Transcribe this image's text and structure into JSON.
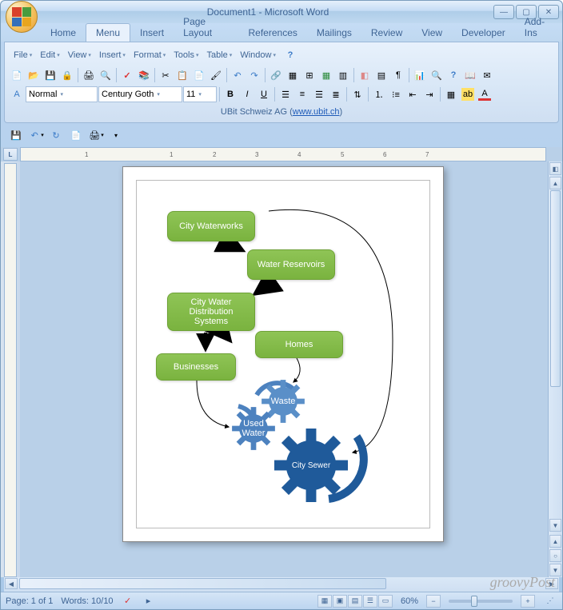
{
  "window": {
    "title": "Document1 - Microsoft Word"
  },
  "tabs": [
    "Home",
    "Menu",
    "Insert",
    "Page Layout",
    "References",
    "Mailings",
    "Review",
    "View",
    "Developer",
    "Add-Ins"
  ],
  "active_tab": 1,
  "menu": {
    "items": [
      "File",
      "Edit",
      "View",
      "Insert",
      "Format",
      "Tools",
      "Table",
      "Window"
    ]
  },
  "toolbar": {
    "style": "Normal",
    "font": "Century Goth",
    "size": "11",
    "bold": "B",
    "italic": "I",
    "underline": "U"
  },
  "ribbon_footer": {
    "company": "UBit Schweiz AG",
    "link": "www.ubit.ch"
  },
  "diagram": {
    "boxes": [
      {
        "label": "City Waterworks"
      },
      {
        "label": "Water Reservoirs"
      },
      {
        "label": "City Water Distribution Systems"
      },
      {
        "label": "Homes"
      },
      {
        "label": "Businesses"
      }
    ],
    "gears": [
      {
        "label": "Waste"
      },
      {
        "label": "Used Water"
      },
      {
        "label": "City Sewer"
      }
    ]
  },
  "status": {
    "page": "Page: 1 of 1",
    "words": "Words: 10/10",
    "zoom": "60%"
  },
  "watermark": "groovyPost",
  "ruler_marks": [
    "1",
    "",
    "1",
    "2",
    "3",
    "4",
    "5",
    "6",
    "7"
  ]
}
